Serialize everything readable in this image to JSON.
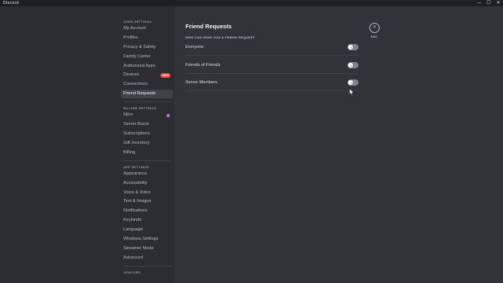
{
  "window": {
    "app_title": "Discord",
    "controls": {
      "minimize": "─",
      "maximize": "☐",
      "close": "✕"
    }
  },
  "sidebar": {
    "user_settings": {
      "header": "USER SETTINGS",
      "items": [
        {
          "label": "My Account"
        },
        {
          "label": "Profiles"
        },
        {
          "label": "Privacy & Safety"
        },
        {
          "label": "Family Center"
        },
        {
          "label": "Authorized Apps"
        },
        {
          "label": "Devices",
          "badge": "NEW"
        },
        {
          "label": "Connections"
        },
        {
          "label": "Friend Requests",
          "selected": true
        }
      ]
    },
    "billing_settings": {
      "header": "BILLING SETTINGS",
      "items": [
        {
          "label": "Nitro"
        },
        {
          "label": "Server Boost"
        },
        {
          "label": "Subscriptions"
        },
        {
          "label": "Gift Inventory"
        },
        {
          "label": "Billing"
        }
      ]
    },
    "app_settings": {
      "header": "APP SETTINGS",
      "items": [
        {
          "label": "Appearance"
        },
        {
          "label": "Accessibility"
        },
        {
          "label": "Voice & Video"
        },
        {
          "label": "Text & Images"
        },
        {
          "label": "Notifications"
        },
        {
          "label": "Keybinds"
        },
        {
          "label": "Language"
        },
        {
          "label": "Windows Settings"
        },
        {
          "label": "Streamer Mode"
        },
        {
          "label": "Advanced"
        }
      ]
    },
    "vencord": {
      "header": "VENCORD"
    }
  },
  "main": {
    "title": "Friend Requests",
    "subheader": "WHO CAN SEND YOU A FRIEND REQUEST",
    "options": [
      {
        "label": "Everyone",
        "enabled": false
      },
      {
        "label": "Friends of Friends",
        "enabled": false
      },
      {
        "label": "Server Members",
        "enabled": false
      }
    ],
    "close": {
      "icon": "close-icon",
      "label": "ESC"
    }
  },
  "colors": {
    "background": "#313338",
    "sidebar": "#2b2d31",
    "titlebar": "#1e1f22",
    "toggle_off": "#80848e",
    "badge_new": "#f23f43",
    "nitro": "#c873e8"
  }
}
